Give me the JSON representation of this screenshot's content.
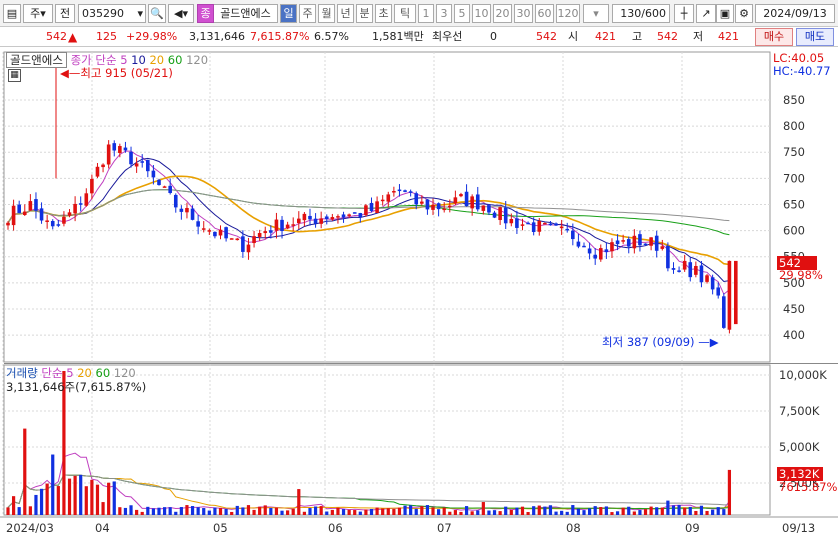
{
  "toolbar": {
    "code": "035290",
    "mode": "주",
    "prefix": "전",
    "name": "골드앤에스",
    "name_badge": "종",
    "periods": [
      "일",
      "주",
      "월",
      "년",
      "분",
      "초",
      "틱"
    ],
    "selected_period": "일",
    "intervals": [
      "1",
      "3",
      "5",
      "10",
      "20",
      "30",
      "60",
      "120"
    ],
    "count": "130/600",
    "date": "2024/09/13"
  },
  "quote": {
    "price": "542",
    "change": "125",
    "change_pct": "+29.98%",
    "volume": "3,131,646",
    "volume_ratio": "7,615.87%",
    "turnover": "6.57%",
    "amount": "1,581백만",
    "priority_label": "최우선",
    "priority_value": "0",
    "bid": "542",
    "open_label": "시",
    "open": "421",
    "high_label": "고",
    "high": "542",
    "low_label": "저",
    "low": "421",
    "buy_label": "매수",
    "sell_label": "매도"
  },
  "price_panel": {
    "legend_name": "골드앤에스",
    "legend_ma": "종가 단순 5",
    "ma_periods": [
      "10",
      "20",
      "60",
      "120"
    ],
    "lc": "LC:40.05",
    "hc": "HC:-40.77",
    "high_note": "최고 915 (05/21)",
    "low_note": "최저 387 (09/09)",
    "last_price": "542",
    "last_pct": "29.98%",
    "y_ticks": [
      "850",
      "800",
      "750",
      "700",
      "650",
      "600",
      "550",
      "500",
      "450",
      "400"
    ]
  },
  "volume_panel": {
    "legend_name": "거래량",
    "legend_ma": "단순 5",
    "ma_periods": [
      "20",
      "60",
      "120"
    ],
    "value_note": "3,131,646주(7,615.87%)",
    "last_volume": "3,132K",
    "last_pct": "7615.87%",
    "y_ticks": [
      "10,000K",
      "7,500K",
      "5,000K",
      "2,500K"
    ]
  },
  "x_axis": {
    "labels": [
      "2024/03",
      "04",
      "05",
      "06",
      "07",
      "08",
      "09"
    ],
    "right_label": "09/13"
  },
  "colors": {
    "up": "#e01010",
    "down": "#1030e0",
    "ma5": "#c040c0",
    "ma10": "#1a1a9a",
    "ma20": "#e8a000",
    "ma60": "#18a018",
    "ma120": "#909090",
    "grid": "#d8d8d8"
  }
}
